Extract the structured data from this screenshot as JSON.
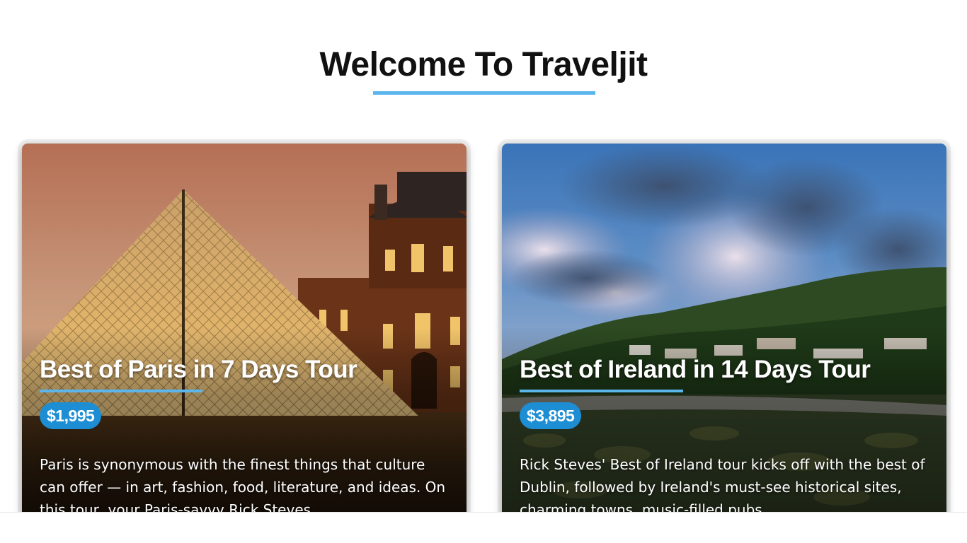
{
  "header": {
    "title": "Welcome To Traveljit"
  },
  "theme": {
    "accent": "#5bb6ec",
    "price_badge": "#1d8ed3"
  },
  "tours": [
    {
      "title": "Best of Paris in 7 Days Tour",
      "price": "$1,995",
      "description": "Paris is synonymous with the finest things that culture can offer — in art, fashion, food, literature, and ideas. On this tour, your Paris-savvy Rick Steves",
      "image": "louvre-pyramid-photo"
    },
    {
      "title": "Best of Ireland in 14 Days Tour",
      "price": "$3,895",
      "description": "Rick Steves' Best of Ireland tour kicks off with the best of Dublin, followed by Ireland's must-see historical sites, charming towns, music-filled pubs",
      "image": "irish-coast-landscape-photo"
    }
  ]
}
